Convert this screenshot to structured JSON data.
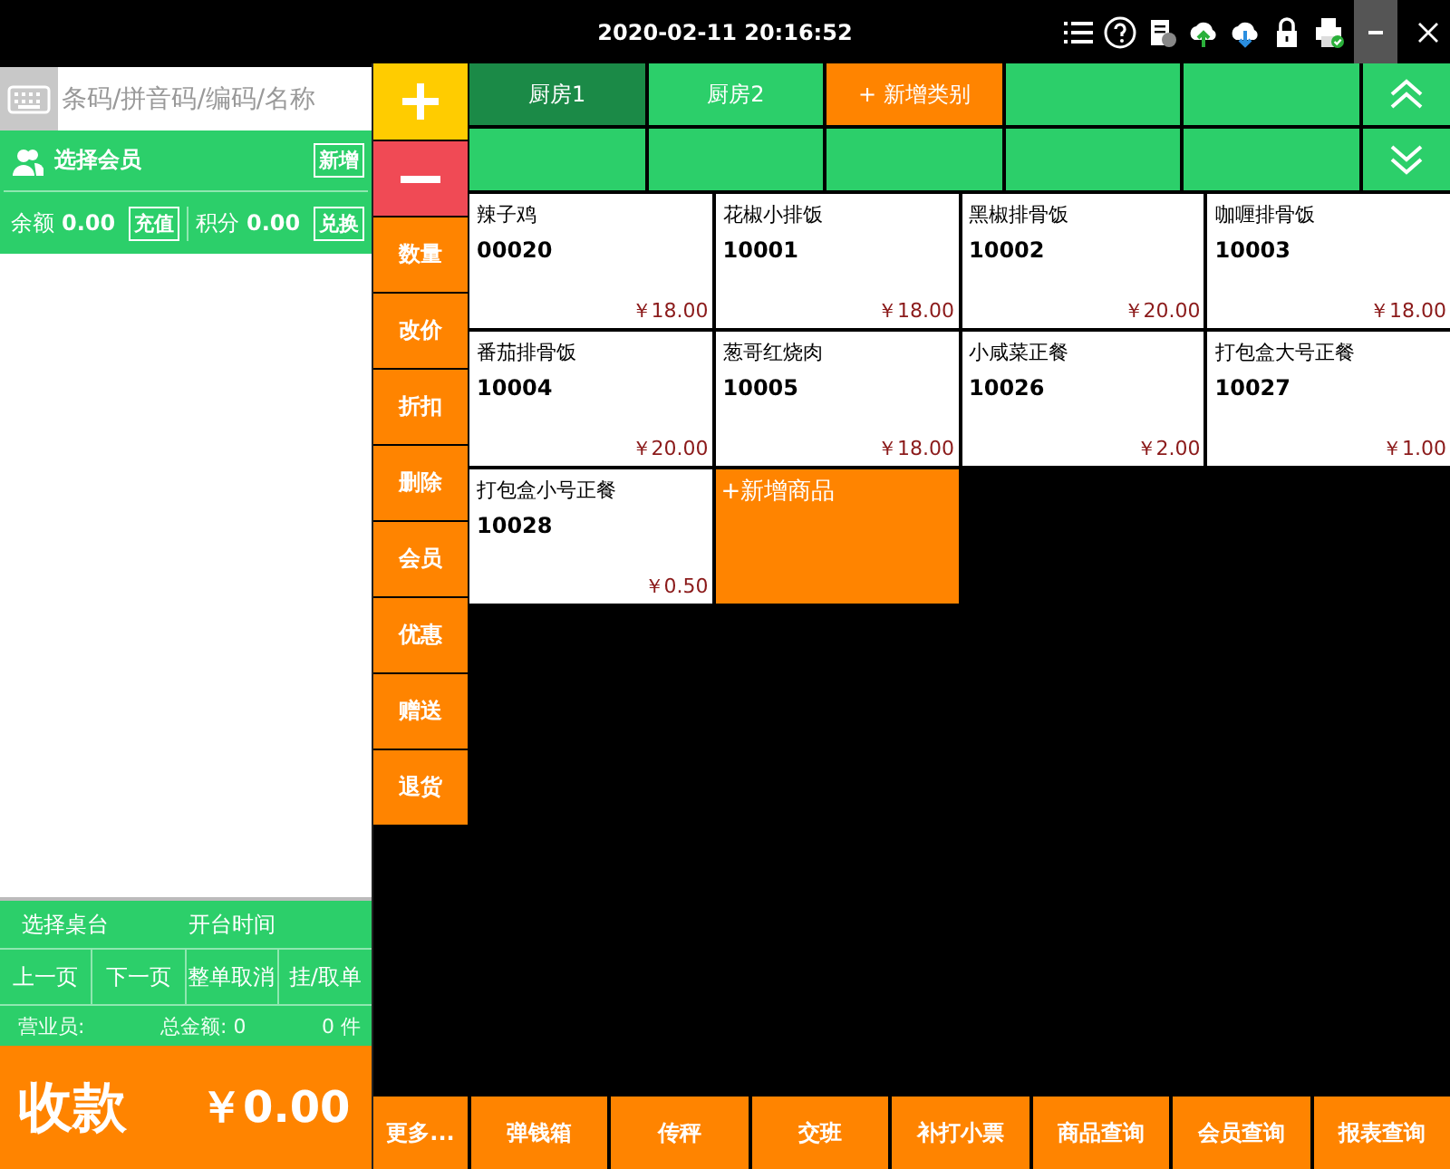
{
  "top_bar": {
    "datetime": "2020-02-11 20:16:52"
  },
  "search": {
    "placeholder": "条码/拼音码/编码/名称"
  },
  "member": {
    "title": "选择会员",
    "add_button": "新增",
    "balance_label": "余额",
    "balance": "0.00",
    "recharge_button": "充值",
    "points_label": "积分",
    "points": "0.00",
    "redeem_button": "兑换"
  },
  "table_info": {
    "select_table": "选择桌台",
    "open_time_label": "开台时间"
  },
  "order_buttons": [
    "上一页",
    "下一页",
    "整单取消",
    "挂/取单"
  ],
  "summary": {
    "clerk_label": "营业员:",
    "total_label": "总金额: 0",
    "count": "0 件"
  },
  "checkout": {
    "label": "收款",
    "amount": "￥0.00"
  },
  "actions": [
    {
      "kind": "add"
    },
    {
      "kind": "remove"
    },
    {
      "kind": "text",
      "label": "数量"
    },
    {
      "kind": "text",
      "label": "改价"
    },
    {
      "kind": "text",
      "label": "折扣"
    },
    {
      "kind": "text",
      "label": "删除"
    },
    {
      "kind": "text",
      "label": "会员"
    },
    {
      "kind": "text",
      "label": "优惠"
    },
    {
      "kind": "text",
      "label": "赠送"
    },
    {
      "kind": "text",
      "label": "退货"
    }
  ],
  "categories": [
    {
      "kind": "category",
      "label": "厨房1",
      "selected": true
    },
    {
      "kind": "category",
      "label": "厨房2",
      "selected": false
    },
    {
      "kind": "add",
      "label": "+ 新增类别",
      "selected": false
    }
  ],
  "products": [
    {
      "kind": "product",
      "name": "辣子鸡",
      "code": "00020",
      "price": "￥18.00"
    },
    {
      "kind": "product",
      "name": "花椒小排饭",
      "code": "10001",
      "price": "￥18.00"
    },
    {
      "kind": "product",
      "name": "黑椒排骨饭",
      "code": "10002",
      "price": "￥20.00"
    },
    {
      "kind": "product",
      "name": "咖喱排骨饭",
      "code": "10003",
      "price": "￥18.00"
    },
    {
      "kind": "product",
      "name": "番茄排骨饭",
      "code": "10004",
      "price": "￥20.00"
    },
    {
      "kind": "product",
      "name": "葱哥红烧肉",
      "code": "10005",
      "price": "￥18.00"
    },
    {
      "kind": "product",
      "name": "小咸菜正餐",
      "code": "10026",
      "price": "￥2.00"
    },
    {
      "kind": "product",
      "name": "打包盒大号正餐",
      "code": "10027",
      "price": "￥1.00"
    },
    {
      "kind": "product",
      "name": "打包盒小号正餐",
      "code": "10028",
      "price": "￥0.50"
    },
    {
      "kind": "add",
      "name": "+新增商品"
    }
  ],
  "bottom_buttons": [
    "更多...",
    "弹钱箱",
    "传秤",
    "交班",
    "补打小票",
    "商品查询",
    "会员查询",
    "报表查询"
  ]
}
